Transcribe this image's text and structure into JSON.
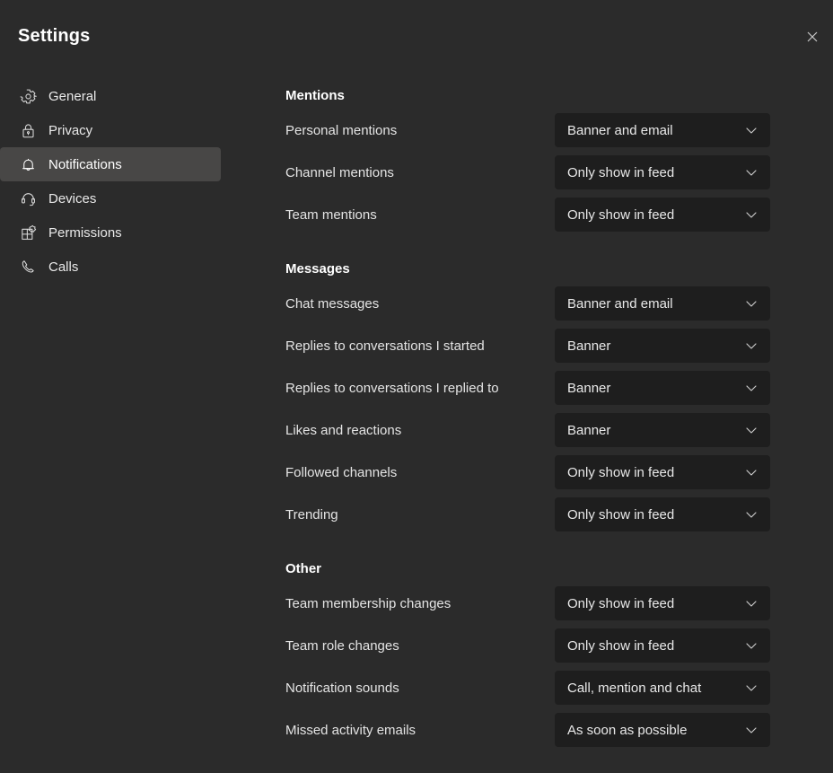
{
  "window": {
    "title": "Settings",
    "close_icon": "close-icon",
    "bg_color": "#2b2b2b",
    "panel_color": "#1e1e1e",
    "selected_color": "#484746"
  },
  "sidebar": {
    "items": [
      {
        "label": "General",
        "icon": "gear-icon",
        "selected": false
      },
      {
        "label": "Privacy",
        "icon": "lock-icon",
        "selected": false
      },
      {
        "label": "Notifications",
        "icon": "bell-icon",
        "selected": true
      },
      {
        "label": "Devices",
        "icon": "headset-icon",
        "selected": false
      },
      {
        "label": "Permissions",
        "icon": "permissions-icon",
        "selected": false
      },
      {
        "label": "Calls",
        "icon": "phone-icon",
        "selected": false
      }
    ]
  },
  "main": {
    "sections": [
      {
        "title": "Mentions",
        "rows": [
          {
            "label": "Personal mentions",
            "value": "Banner and email"
          },
          {
            "label": "Channel mentions",
            "value": "Only show in feed"
          },
          {
            "label": "Team mentions",
            "value": "Only show in feed"
          }
        ]
      },
      {
        "title": "Messages",
        "rows": [
          {
            "label": "Chat messages",
            "value": "Banner and email"
          },
          {
            "label": "Replies to conversations I started",
            "value": "Banner"
          },
          {
            "label": "Replies to conversations I replied to",
            "value": "Banner"
          },
          {
            "label": "Likes and reactions",
            "value": "Banner"
          },
          {
            "label": "Followed channels",
            "value": "Only show in feed"
          },
          {
            "label": "Trending",
            "value": "Only show in feed"
          }
        ]
      },
      {
        "title": "Other",
        "rows": [
          {
            "label": "Team membership changes",
            "value": "Only show in feed"
          },
          {
            "label": "Team role changes",
            "value": "Only show in feed"
          },
          {
            "label": "Notification sounds",
            "value": "Call, mention and chat"
          },
          {
            "label": "Missed activity emails",
            "value": "As soon as possible"
          }
        ]
      }
    ]
  }
}
